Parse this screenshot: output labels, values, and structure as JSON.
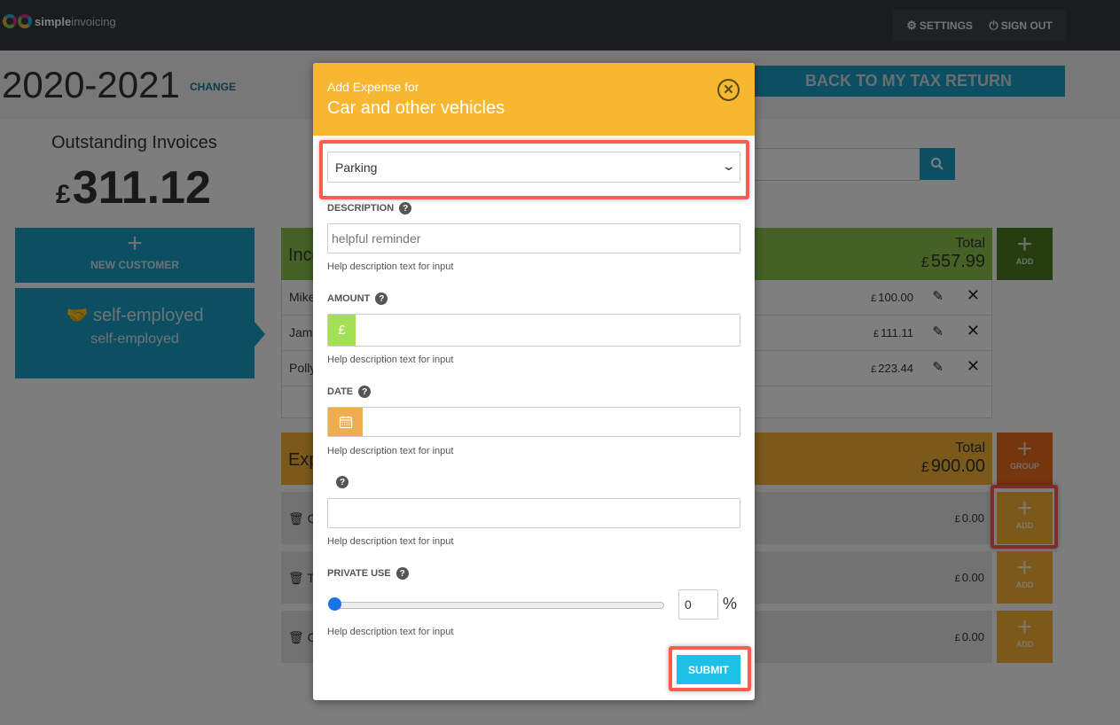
{
  "nav": {
    "logo_bold": "simple",
    "logo_light": "invoicing",
    "settings_label": "SETTINGS",
    "signout_label": "SIGN OUT"
  },
  "page": {
    "year": "2020-2021",
    "change_label": "CHANGE",
    "back_label": "BACK TO MY TAX RETURN",
    "outstanding_title": "Outstanding Invoices",
    "outstanding_currency": "£",
    "outstanding_value": "311.12",
    "new_customer_label": "NEW CUSTOMER",
    "customer": {
      "name": "self-employed",
      "type": "self-employed"
    }
  },
  "income": {
    "title": "Income",
    "total_label": "Total",
    "total_currency": "£",
    "total_value": "557.99",
    "add_label": "ADD",
    "rows": [
      {
        "name": "Mike",
        "currency": "£",
        "amount": "100.00"
      },
      {
        "name": "James",
        "currency": "£",
        "amount": "111.11"
      },
      {
        "name": "Polly",
        "currency": "£",
        "amount": "223.44"
      }
    ]
  },
  "expenses": {
    "title": "Expenses",
    "total_label": "Total",
    "total_currency": "£",
    "total_value": "900.00",
    "group_label": "GROUP",
    "add_label": "ADD",
    "rows": [
      {
        "name": "Car and other vehicles",
        "currency": "£",
        "amount": "0.00"
      },
      {
        "name": "Travel",
        "currency": "£",
        "amount": "0.00"
      },
      {
        "name": "Other",
        "currency": "£",
        "amount": "0.00"
      }
    ]
  },
  "modal": {
    "subtitle": "Add Expense for",
    "title": "Car and other vehicles",
    "category_selected": "Parking",
    "description_label": "DESCRIPTION",
    "description_placeholder": "helpful reminder",
    "description_value": "",
    "amount_label": "AMOUNT",
    "amount_currency": "£",
    "amount_value": "",
    "date_label": "DATE",
    "date_value": "",
    "unnamed_label": "",
    "unnamed_value": "",
    "private_use_label": "PRIVATE USE",
    "private_use_value": "0",
    "private_use_fraction": 0,
    "percent_sign": "%",
    "help_text": "Help description text for input",
    "submit_label": "SUBMIT"
  }
}
